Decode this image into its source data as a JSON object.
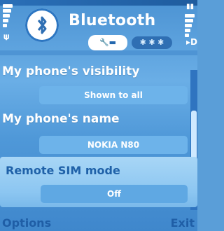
{
  "header": {
    "title": "Bluetooth",
    "tabs": [
      {
        "icon": "wrench-tab-icon",
        "active": true
      },
      {
        "icon": "bluetooth-devices-tab-icon",
        "active": false
      }
    ],
    "more_tabs_indicator": "▸",
    "more_tabs_letter": "D"
  },
  "settings": [
    {
      "label": "My phone's visibility",
      "value": "Shown to all"
    },
    {
      "label": "My phone's name",
      "value": "NOKIA N80"
    },
    {
      "label": "Remote SIM mode",
      "value": "Off"
    }
  ],
  "softkeys": {
    "left": "Options",
    "right": "Exit"
  }
}
